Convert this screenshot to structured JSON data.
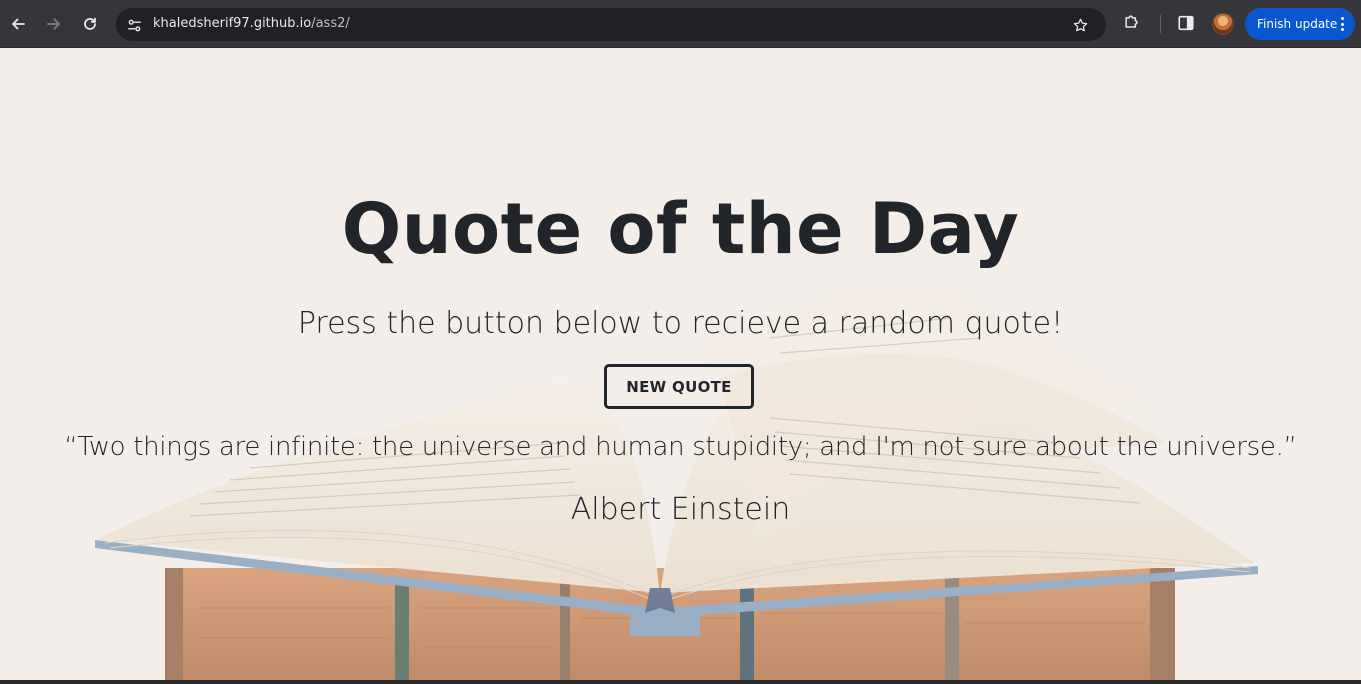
{
  "browser": {
    "url_host": "khaledsherif97.github.io",
    "url_path": "/ass2/",
    "update_button_label": "Finish update",
    "accent": "#0b57d0"
  },
  "page": {
    "title": "Quote of the Day",
    "subtitle": "Press the button below to recieve a random quote!",
    "button_label": "NEW QUOTE",
    "quote": "“Two things are infinite: the universe and human stupidity; and I'm not sure about the universe.”",
    "author": "Albert Einstein",
    "text_color": "#212529"
  }
}
